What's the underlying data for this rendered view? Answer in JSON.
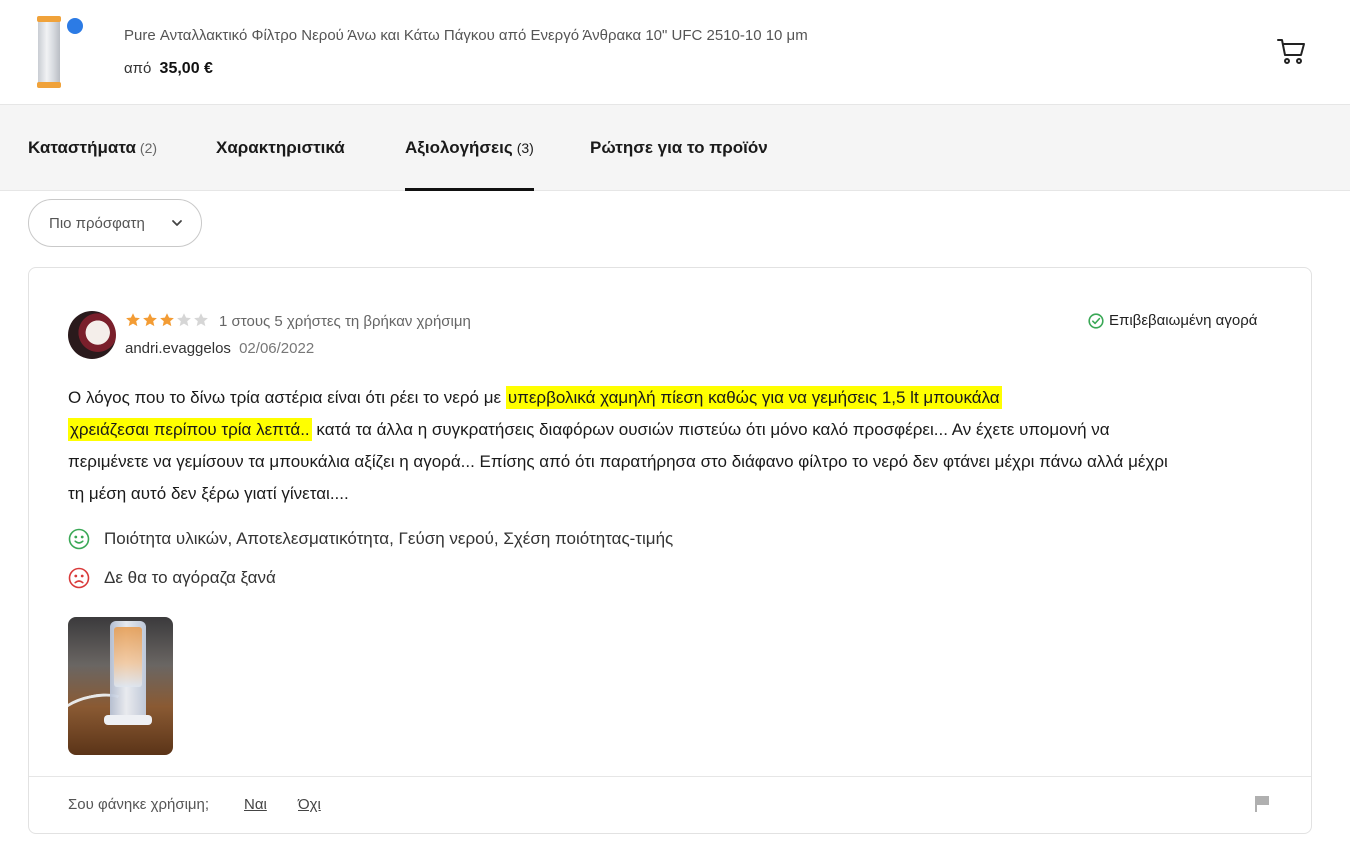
{
  "product": {
    "title": "Pure Ανταλλακτικό Φίλτρο Νερού Άνω και Κάτω Πάγκου από Ενεργό Άνθρακα 10\" UFC 2510-10 10 μm",
    "price_prefix": "από",
    "price": "35,00 €",
    "thumbnail_icon": "filter-cartridge-image",
    "cart_icon": "cart-icon"
  },
  "tabs": [
    {
      "label": "Καταστήματα",
      "count": "(2)"
    },
    {
      "label": "Χαρακτηριστικά",
      "count": ""
    },
    {
      "label": "Αξιολογήσεις",
      "count": "(3)"
    },
    {
      "label": "Ρώτησε για το προϊόν",
      "count": ""
    }
  ],
  "active_tab": "Αξιολογήσεις",
  "sort": {
    "label": "Πιο πρόσφατη"
  },
  "review": {
    "rating": 3,
    "max_rating": 5,
    "helpful_text": "1 στους 5 χρήστες τη βρήκαν χρήσιμη",
    "author": "andri.evaggelos",
    "date": "02/06/2022",
    "verified_label": "Επιβεβαιωμένη αγορά",
    "text_before": "Ο λόγος που το δίνω τρία αστέρια είναι ότι ρέει το νερό με ",
    "text_highlight_1": "υπερβολικά χαμηλή πίεση καθώς για να γεμήσεις 1,5 lt μπουκάλα",
    "text_highlight_2": "χρειάζεσαι περίπου τρία λεπτά..",
    "text_after": " κατά τα άλλα η συγκρατήσεις διαφόρων ουσιών πιστεύω ότι μόνο καλό προσφέρει... Αν έχετε υπομονή να περιμένετε να γεμίσουν τα μπουκάλια αξίζει η αγορά... Επίσης από ότι παρατήρησα στο διάφανο φίλτρο το νερό δεν φτάνει μέχρι πάνω αλλά μέχρι τη μέση αυτό δεν ξέρω γιατί γίνεται....",
    "pros": "Ποιότητα υλικών, Αποτελεσματικότητα, Γεύση νερού, Σχέση ποιότητας-τιμής",
    "cons": "Δε θα το αγόραζα ξανά",
    "photo_icon": "review-photo-image"
  },
  "footer": {
    "helpful_question": "Σου φάνηκε χρήσιμη;",
    "yes": "Ναι",
    "no": "Όχι",
    "flag_icon": "flag-icon"
  },
  "colors": {
    "star_filled": "#f39c34",
    "star_empty": "#d6d6d6",
    "verified_green": "#3aa856",
    "pros_green": "#3aa856",
    "cons_red": "#d93a3a",
    "highlight": "#ffff00"
  }
}
